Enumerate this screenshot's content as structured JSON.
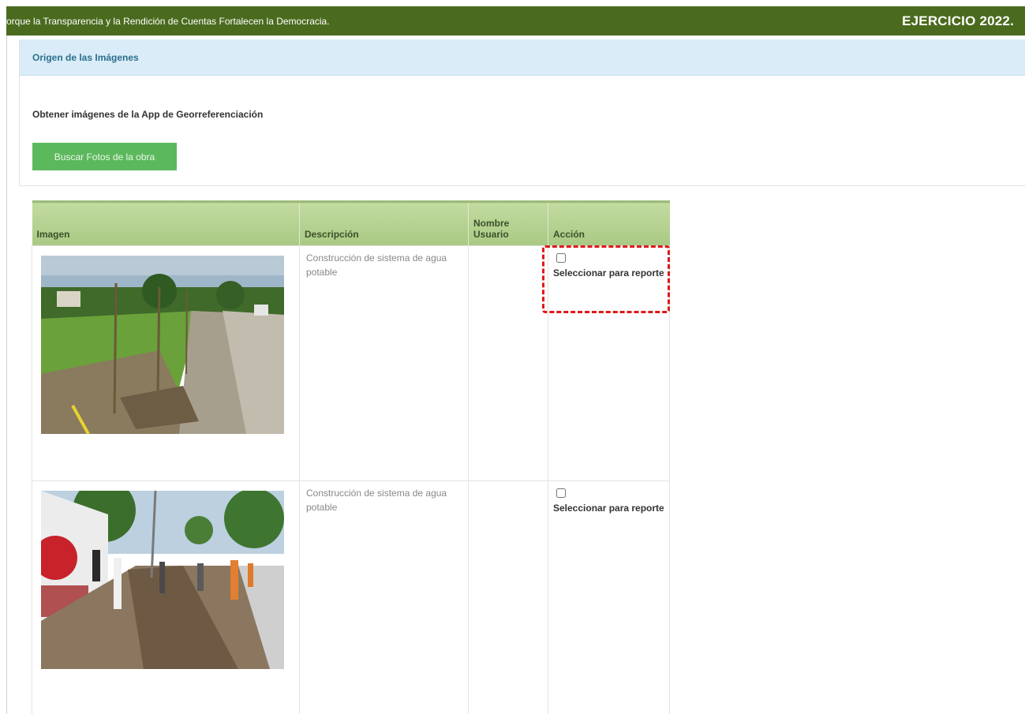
{
  "header": {
    "motto": "Porque la Transparencia y la Rendición de Cuentas Fortalecen la Democracia.",
    "year": "EJERCICIO 2022."
  },
  "panel": {
    "title": "Origen de las Imágenes",
    "label": "Obtener imágenes de la App de Georreferenciación",
    "search_button": "Buscar Fotos de la obra"
  },
  "table": {
    "columns": [
      "Imagen",
      "Descripción",
      "Nombre Usuario",
      "Acción"
    ],
    "rows": [
      {
        "description": "Construcción de sistema de agua potable",
        "user": "",
        "action_label": "Seleccionar para reporte",
        "selected": false
      },
      {
        "description": "Construcción de sistema de agua potable",
        "user": "",
        "action_label": "Seleccionar para reporte",
        "selected": false
      }
    ]
  },
  "colors": {
    "topbar": "#4a6b1e",
    "panel_header": "#d9ecf7",
    "button": "#5cb85c",
    "table_header": "#b5d192",
    "highlight": "#e01818"
  }
}
